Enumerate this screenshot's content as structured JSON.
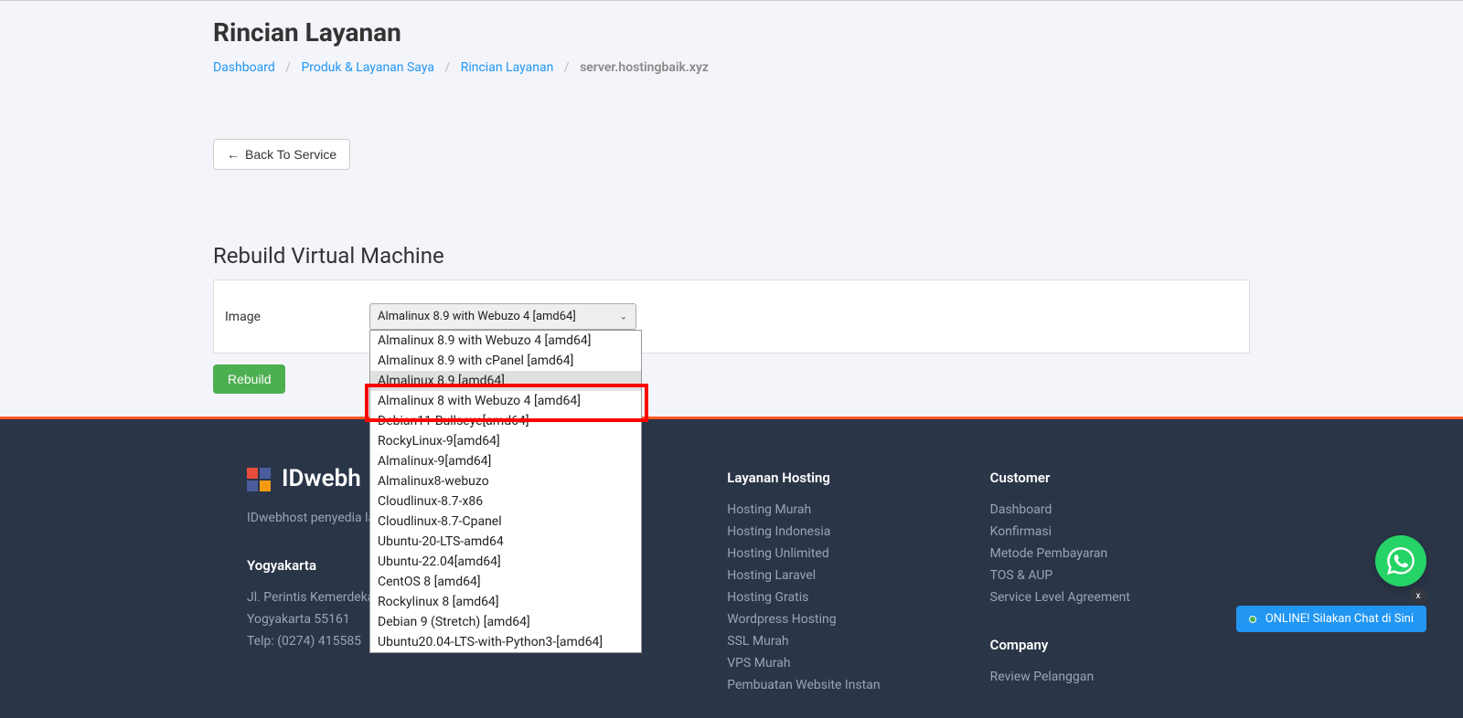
{
  "page": {
    "title": "Rincian Layanan"
  },
  "breadcrumb": {
    "items": [
      {
        "label": "Dashboard"
      },
      {
        "label": "Produk & Layanan Saya"
      },
      {
        "label": "Rincian Layanan"
      }
    ],
    "current": "server.hostingbaik.xyz"
  },
  "back_button": {
    "label": "Back To Service"
  },
  "rebuild": {
    "section_title": "Rebuild Virtual Machine",
    "image_label": "Image",
    "selected": "Almalinux 8.9 with Webuzo 4 [amd64]",
    "button_label": "Rebuild",
    "options": [
      "Almalinux 8.9 with Webuzo 4 [amd64]",
      "Almalinux 8.9 with cPanel [amd64]",
      "Almalinux 8.9 [amd64]",
      "Almalinux 8 with Webuzo 4 [amd64]",
      "Debian11-Bullseye[amd64]",
      "RockyLinux-9[amd64]",
      "Almalinux-9[amd64]",
      "Almalinux8-webuzo",
      "Cloudlinux-8.7-x86",
      "Cloudlinux-8.7-Cpanel",
      "Ubuntu-20-LTS-amd64",
      "Ubuntu-22.04[amd64]",
      "CentOS 8 [amd64]",
      "Rockylinux 8 [amd64]",
      "Debian 9 (Stretch) [amd64]",
      "Ubuntu20.04-LTS-with-Python3-[amd64]"
    ]
  },
  "footer": {
    "brand": "IDwebh",
    "desc": "IDwebhost penyedia la",
    "address_heading": "Yogyakarta",
    "address_lines": [
      "Jl. Perintis Kemerdeka",
      "Yogyakarta 55161",
      "Telp: (0274) 415585"
    ],
    "columns": {
      "hosting": {
        "heading": "Layanan Hosting",
        "links": [
          "Hosting Murah",
          "Hosting Indonesia",
          "Hosting Unlimited",
          "Hosting Laravel",
          "Hosting Gratis",
          "Wordpress Hosting",
          "SSL Murah",
          "VPS Murah",
          "Pembuatan Website Instan"
        ]
      },
      "customer": {
        "heading": "Customer",
        "links": [
          "Dashboard",
          "Konfirmasi",
          "Metode Pembayaran",
          "TOS & AUP",
          "Service Level Agreement"
        ]
      },
      "company": {
        "heading": "Company",
        "links": [
          "Review Pelanggan"
        ]
      }
    }
  },
  "chat": {
    "label": "ONLINE! Silakan Chat di Sini",
    "close": "x"
  }
}
